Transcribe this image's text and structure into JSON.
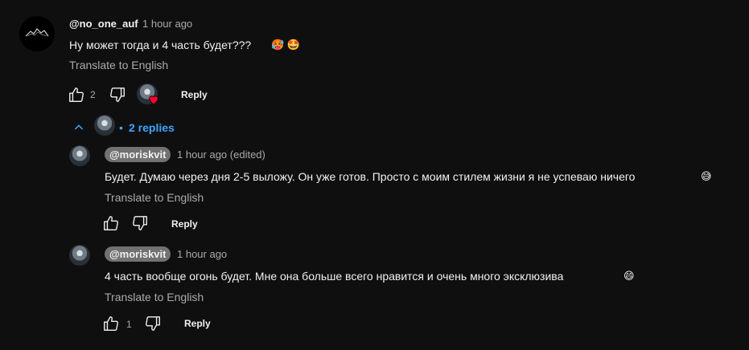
{
  "main_comment": {
    "author": "@no_one_auf",
    "time": "1 hour ago",
    "text": "Ну может тогда и 4 часть будет???",
    "emoji": "🥵 🤩",
    "translate": "Translate to English",
    "like_count": "2",
    "reply_label": "Reply"
  },
  "replies_toggle": {
    "count_label": "2 replies",
    "dot": "•"
  },
  "replies": [
    {
      "author": "@moriskvit",
      "time": "1 hour ago (edited)",
      "text": "Будет. Думаю через дня 2-5 выложу. Он уже готов. Просто с моим стилем жизни я не успеваю ничего",
      "emoji": "😅",
      "translate": "Translate to English",
      "like_count": "",
      "reply_label": "Reply"
    },
    {
      "author": "@moriskvit",
      "time": "1 hour ago",
      "text": "4 часть вообще огонь будет. Мне она больше всего нравится и очень много эксклюзива",
      "emoji": "😄",
      "translate": "Translate to English",
      "like_count": "1",
      "reply_label": "Reply"
    }
  ],
  "colors": {
    "background": "#0f0f0f",
    "link_blue": "#3ea6ff",
    "heart": "#ff0033",
    "muted": "#aaaaaa"
  },
  "icons": {
    "like": "thumbs-up-icon",
    "dislike": "thumbs-down-icon",
    "heart": "creator-heart-icon",
    "chevron": "chevron-up-icon"
  }
}
